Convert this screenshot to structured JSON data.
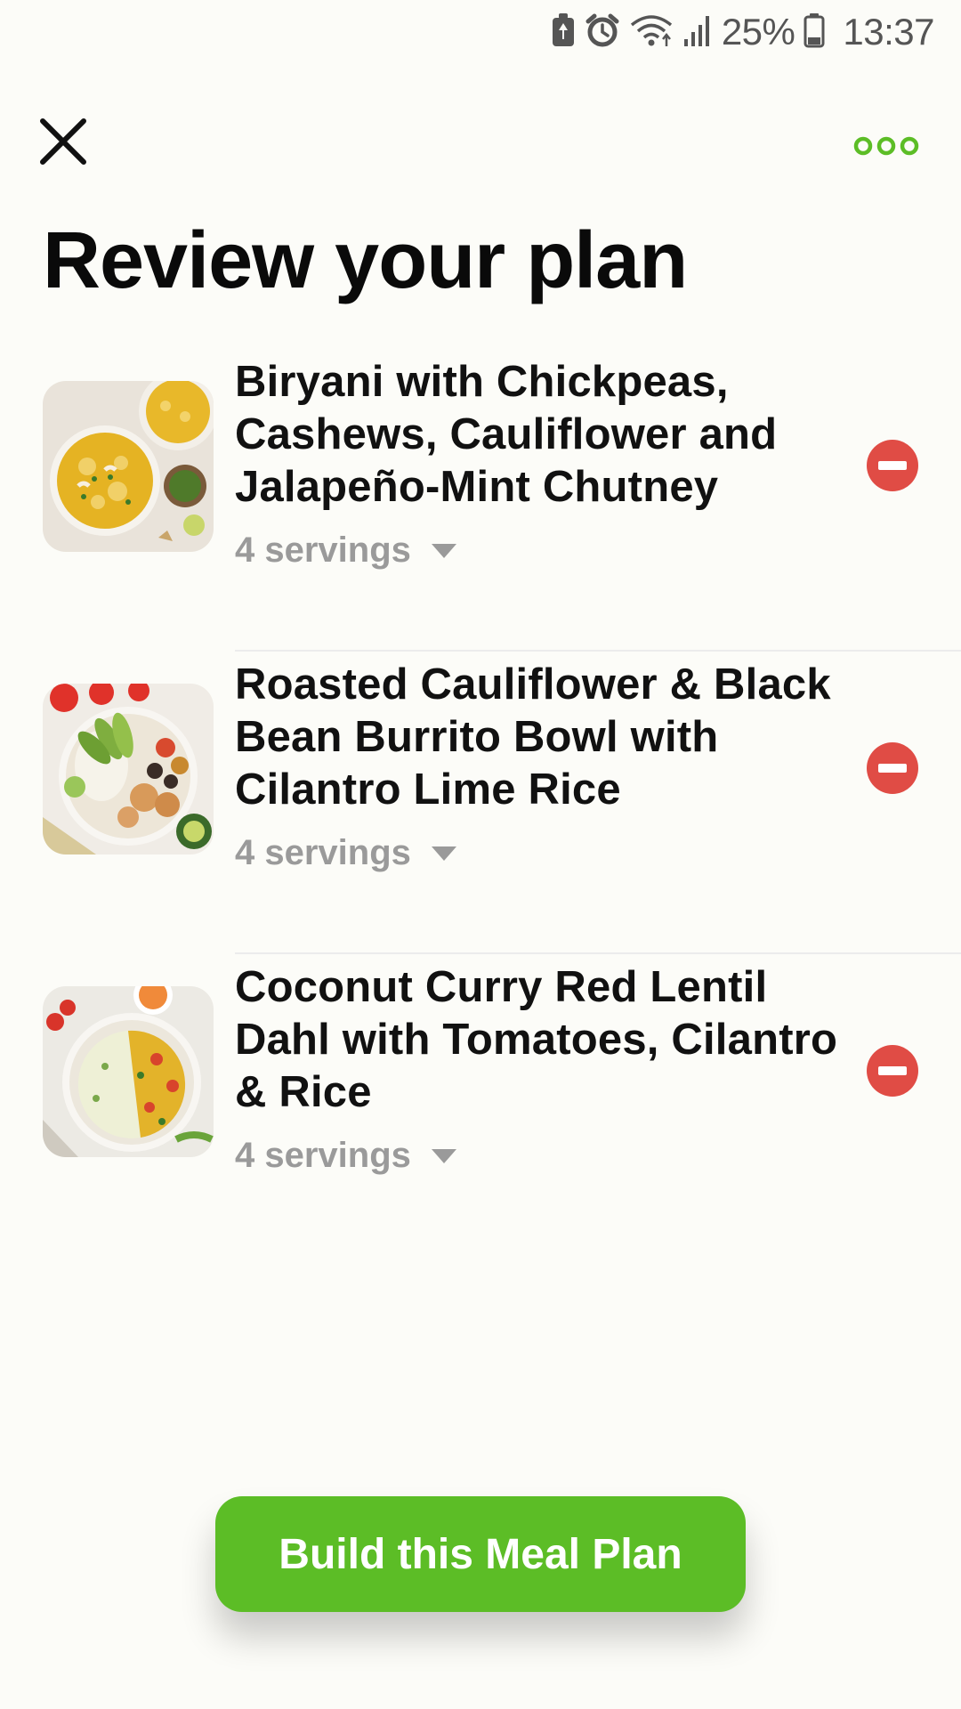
{
  "status_bar": {
    "icons": [
      "battery-saver-icon",
      "alarm-icon",
      "wifi-icon",
      "signal-icon",
      "battery-icon"
    ],
    "battery": "25%",
    "time": "13:37"
  },
  "header": {
    "close_icon": "close-icon",
    "more_icon": "more-options-icon",
    "accent_color": "#5cbd26"
  },
  "title": "Review your plan",
  "recipes": [
    {
      "title": "Biryani with Chickpeas,\nCashews, Cauliflower and\nJalapeño-Mint Chutney",
      "servings": "4 servings",
      "image": "biryani-thumbnail"
    },
    {
      "title": "Roasted Cauliflower & Black\nBean Burrito Bowl with\nCilantro Lime Rice",
      "servings": "4 servings",
      "image": "burrito-bowl-thumbnail"
    },
    {
      "title": " Coconut Curry Red Lentil\nDahl with Tomatoes, Cilantro\n& Rice",
      "servings": "4 servings",
      "image": "lentil-dahl-thumbnail"
    }
  ],
  "remove_color": "#e04c45",
  "cta": {
    "label": "Build this Meal Plan",
    "color": "#5cbd26"
  }
}
